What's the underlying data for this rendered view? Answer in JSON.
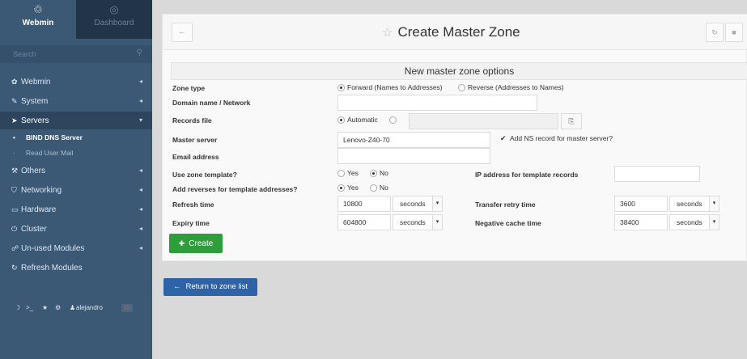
{
  "sidebar": {
    "webmin_label": "Webmin",
    "dashboard_label": "Dashboard",
    "search_placeholder": "Search",
    "nav": {
      "webmin": "Webmin",
      "system": "System",
      "servers": "Servers",
      "others": "Others",
      "networking": "Networking",
      "hardware": "Hardware",
      "cluster": "Cluster",
      "unused": "Un-used Modules",
      "refresh": "Refresh Modules"
    },
    "sub": {
      "bind": "BIND DNS Server",
      "read_mail": "Read User Mail"
    },
    "user": "alejandro"
  },
  "header": {
    "title": "Create Master Zone"
  },
  "form": {
    "section_title": "New master zone options",
    "zone_type": {
      "label": "Zone type",
      "forward": "Forward (Names to Addresses)",
      "reverse": "Reverse (Addresses to Names)"
    },
    "domain": {
      "label": "Domain name / Network",
      "value": ""
    },
    "records_file": {
      "label": "Records file",
      "automatic": "Automatic",
      "value": ""
    },
    "master_server": {
      "label": "Master server",
      "value": "Lenovo-Z40-70",
      "ns_label": "Add NS record for master server?"
    },
    "email": {
      "label": "Email address",
      "value": ""
    },
    "use_template": {
      "label": "Use zone template?",
      "yes": "Yes",
      "no": "No"
    },
    "ip_template": {
      "label": "IP address for template records",
      "value": ""
    },
    "add_reverses": {
      "label": "Add reverses for template addresses?",
      "yes": "Yes",
      "no": "No"
    },
    "refresh": {
      "label": "Refresh time",
      "value": "10800",
      "unit": "seconds"
    },
    "transfer_retry": {
      "label": "Transfer retry time",
      "value": "3600",
      "unit": "seconds"
    },
    "expiry": {
      "label": "Expiry time",
      "value": "604800",
      "unit": "seconds"
    },
    "negative_cache": {
      "label": "Negative cache time",
      "value": "38400",
      "unit": "seconds"
    }
  },
  "buttons": {
    "create": "Create",
    "return": "Return to zone list"
  },
  "colors": {
    "sidebar": "#3b5975",
    "create": "#2e9d3c",
    "return": "#2f63a8"
  }
}
